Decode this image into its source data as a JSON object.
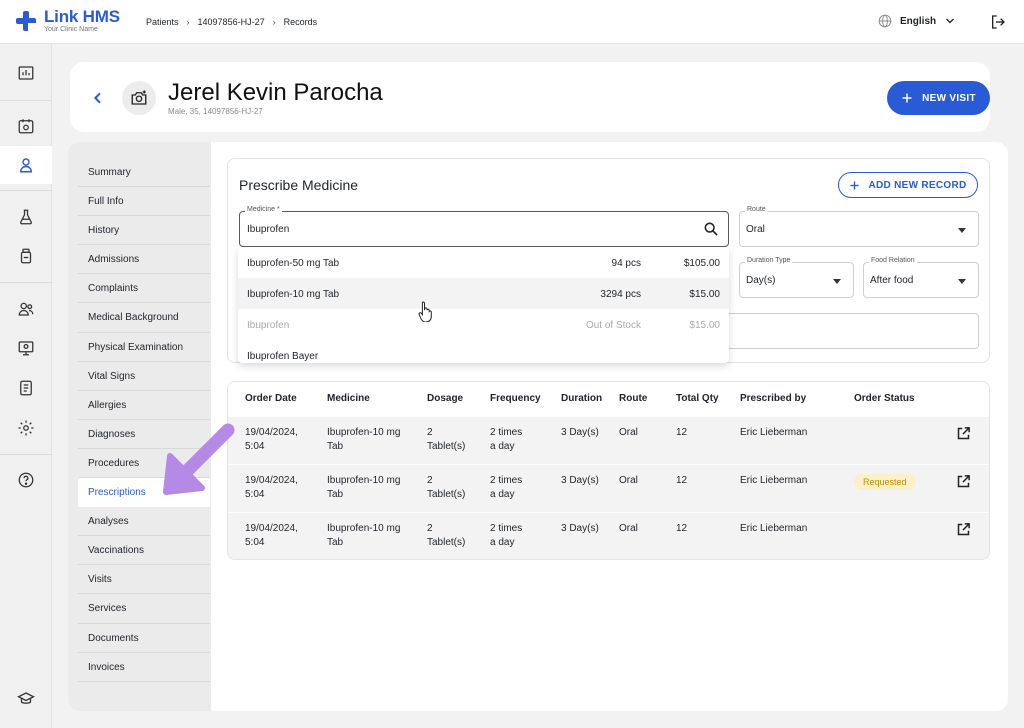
{
  "app": {
    "name": "Link HMS",
    "subtitle": "Your Clinic Name",
    "brand_color": "#2a5bd7"
  },
  "breadcrumb": [
    "Patients",
    "14097856-HJ-27",
    "Records"
  ],
  "language": "English",
  "rail_icons": [
    "dashboard-icon",
    "calendar-icon",
    "patient-icon",
    "lab-icon",
    "medicine-icon",
    "staff-icon",
    "monitor-icon",
    "report-icon",
    "settings-icon",
    "help-icon",
    "education-icon"
  ],
  "patient": {
    "name": "Jerel Kevin Parocha",
    "meta": "Male, 35, 14097856-HJ-27"
  },
  "new_visit_label": "NEW VISIT",
  "sub_nav": {
    "items": [
      "Summary",
      "Full Info",
      "History",
      "Admissions",
      "Complaints",
      "Medical Background",
      "Physical Examination",
      "Vital Signs",
      "Allergies",
      "Diagnoses",
      "Procedures",
      "Prescriptions",
      "Analyses",
      "Vaccinations",
      "Visits",
      "Services",
      "Documents",
      "Invoices"
    ],
    "active": "Prescriptions"
  },
  "prescribe": {
    "title": "Prescribe Medicine",
    "add_record_label": "ADD NEW RECORD",
    "medicine_label": "Medicine *",
    "medicine_value": "Ibuprofen",
    "route_label": "Route",
    "route_value": "Oral",
    "duration_type_label": "Duration Type",
    "duration_type_value": "Day(s)",
    "food_relation_label": "Food Relation",
    "food_relation_value": "After food",
    "suggestions": [
      {
        "name": "Ibuprofen-50 mg Tab",
        "qty": "94 pcs",
        "price": "$105.00",
        "state": "normal"
      },
      {
        "name": "Ibuprofen-10 mg Tab",
        "qty": "3294 pcs",
        "price": "$15.00",
        "state": "hover"
      },
      {
        "name": "Ibuprofen",
        "qty": "Out of Stock",
        "price": "$15.00",
        "state": "disabled"
      },
      {
        "name": "Ibuprofen Bayer",
        "qty": "",
        "price": "",
        "state": "normal"
      }
    ]
  },
  "orders": {
    "headers": [
      "Order Date",
      "Medicine",
      "Dosage",
      "Frequency",
      "Duration",
      "Route",
      "Total Qty",
      "Prescribed by",
      "Order Status"
    ],
    "rows": [
      {
        "date": [
          "19/04/2024,",
          "5:04"
        ],
        "medicine": [
          "Ibuprofen-10 mg",
          "Tab"
        ],
        "dosage": [
          "2",
          "Tablet(s)"
        ],
        "frequency": [
          "2 times",
          "a day"
        ],
        "duration": "3 Day(s)",
        "route": "Oral",
        "qty": "12",
        "by": "Eric Lieberman",
        "status": ""
      },
      {
        "date": [
          "19/04/2024,",
          "5:04"
        ],
        "medicine": [
          "Ibuprofen-10 mg",
          "Tab"
        ],
        "dosage": [
          "2",
          "Tablet(s)"
        ],
        "frequency": [
          "2 times",
          "a day"
        ],
        "duration": "3 Day(s)",
        "route": "Oral",
        "qty": "12",
        "by": "Eric Lieberman",
        "status": "Requested"
      },
      {
        "date": [
          "19/04/2024,",
          "5:04"
        ],
        "medicine": [
          "Ibuprofen-10 mg",
          "Tab"
        ],
        "dosage": [
          "2",
          "Tablet(s)"
        ],
        "frequency": [
          "2 times",
          "a day"
        ],
        "duration": "3 Day(s)",
        "route": "Oral",
        "qty": "12",
        "by": "Eric Lieberman",
        "status": ""
      }
    ]
  },
  "colors": {
    "accent": "#2a5bd7",
    "arrow": "#b48ae6",
    "badge_bg": "#fbf0c7",
    "badge_text": "#c58c00"
  }
}
